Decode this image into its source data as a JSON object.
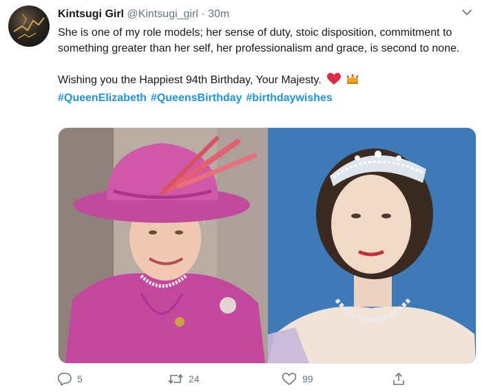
{
  "tweet": {
    "author_name": "Kintsugi Girl",
    "handle": "@Kintsugi_girl",
    "separator": "·",
    "time": "30m",
    "text_line1": "She is one of my role models; her sense of duty, stoic disposition, commitment to something greater than her self, her professionalism and grace, is second to none.",
    "text_line2": "Wishing you the Happiest 94th Birthday, Your Majesty.",
    "hashtags": [
      "#QueenElizabeth",
      "#QueensBirthday",
      "#birthdaywishes"
    ],
    "emoji": [
      "heart-emoji",
      "crown-emoji"
    ]
  },
  "media": {
    "images": [
      "queen-pink-hat-photo",
      "queen-tiara-portrait-photo"
    ]
  },
  "actions": {
    "reply_count": "5",
    "retweet_count": "24",
    "like_count": "99"
  },
  "colors": {
    "link": "#1b95e0",
    "secondary_text": "#657786",
    "heart": "#e0245e"
  },
  "icons": [
    "reply-icon",
    "retweet-icon",
    "like-icon",
    "share-icon",
    "chevron-down-icon"
  ]
}
